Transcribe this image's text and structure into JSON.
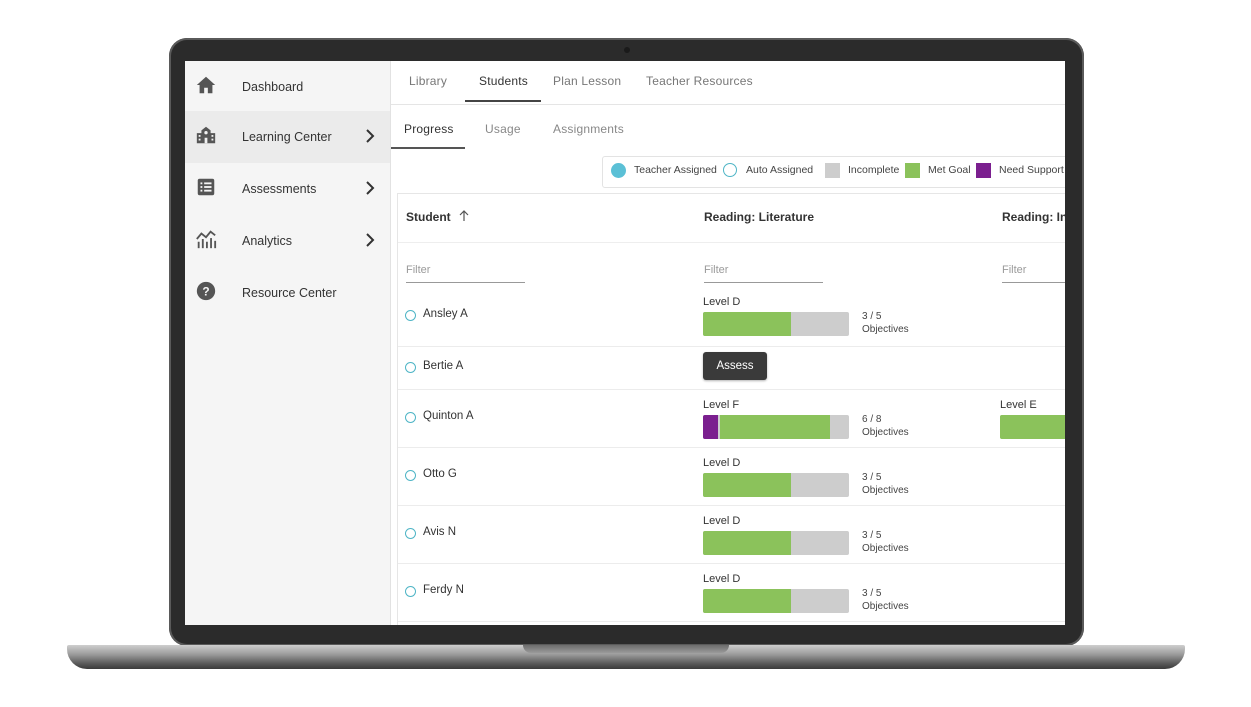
{
  "colors": {
    "met_goal": "#8bc25b",
    "need_support": "#7b1f8f",
    "incomplete": "#cdcdcd",
    "teacher_assigned": "#5bc0d6",
    "auto_assigned_ring": "#4fb5c6"
  },
  "sidebar": {
    "items": [
      {
        "label": "Dashboard",
        "icon": "home-icon",
        "has_chevron": false,
        "active": false
      },
      {
        "label": "Learning Center",
        "icon": "school-icon",
        "has_chevron": true,
        "active": true
      },
      {
        "label": "Assessments",
        "icon": "list-icon",
        "has_chevron": true,
        "active": false
      },
      {
        "label": "Analytics",
        "icon": "chart-icon",
        "has_chevron": true,
        "active": false
      },
      {
        "label": "Resource Center",
        "icon": "help-icon",
        "has_chevron": false,
        "active": false
      }
    ]
  },
  "topnav": {
    "tabs": [
      "Library",
      "Students",
      "Plan Lesson",
      "Teacher Resources"
    ],
    "active": "Students"
  },
  "subnav": {
    "tabs": [
      "Progress",
      "Usage",
      "Assignments"
    ],
    "active": "Progress"
  },
  "legend": {
    "teacher_assigned": "Teacher Assigned",
    "auto_assigned": "Auto Assigned",
    "incomplete": "Incomplete",
    "met_goal": "Met Goal",
    "need_support": "Need Support"
  },
  "table": {
    "headers": {
      "student": "Student",
      "col1": "Reading: Literature",
      "col2": "Reading: Inf"
    },
    "filter_placeholder": "Filter",
    "objectives_label": "Objectives",
    "assess_label": "Assess",
    "rows": [
      {
        "name": "Ansley A",
        "level": "Level D",
        "met": 3,
        "total": 5,
        "support": 0,
        "objectives": "3 / 5"
      },
      {
        "name": "Bertie A",
        "assess": true
      },
      {
        "name": "Quinton A",
        "level": "Level F",
        "met": 6,
        "total": 8,
        "support": 1,
        "objectives": "6 / 8",
        "level2": "Level E",
        "level2_fill": 1.0
      },
      {
        "name": "Otto G",
        "level": "Level D",
        "met": 3,
        "total": 5,
        "support": 0,
        "objectives": "3 / 5"
      },
      {
        "name": "Avis N",
        "level": "Level D",
        "met": 3,
        "total": 5,
        "support": 0,
        "objectives": "3 / 5"
      },
      {
        "name": "Ferdy N",
        "level": "Level D",
        "met": 3,
        "total": 5,
        "support": 0,
        "objectives": "3 / 5"
      }
    ]
  }
}
